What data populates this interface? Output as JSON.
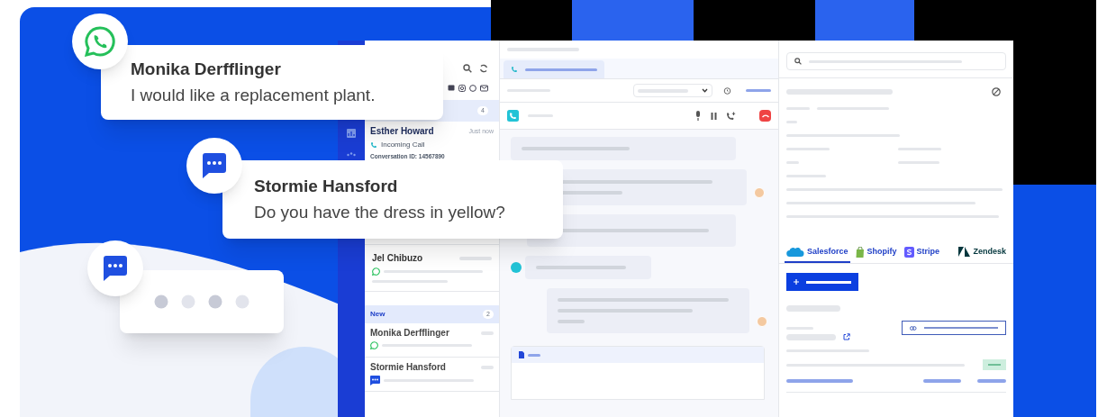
{
  "floating_messages": [
    {
      "kind": "whatsapp",
      "sender": "Monika Derfflinger",
      "text": "I would like a replacement plant."
    },
    {
      "kind": "chat",
      "sender": "Stormie Hansford",
      "text": "Do you have the dress in yellow?"
    },
    {
      "kind": "typing"
    }
  ],
  "conversation_list": {
    "open_count": "4",
    "active": {
      "name": "Esther Howard",
      "time": "Just now",
      "status": "Incoming Call",
      "conversation_id": "Conversation ID: 14567890"
    },
    "items": [
      {
        "name": "Jel Chibuzo",
        "kind": "whatsapp"
      }
    ],
    "new_section": {
      "label": "New",
      "count": "2",
      "items": [
        {
          "name": "Monika Derfflinger",
          "kind": "whatsapp"
        },
        {
          "name": "Stormie Hansford",
          "kind": "chat"
        }
      ]
    }
  },
  "integration_tabs": [
    {
      "label": "Salesforce",
      "kind": "salesforce",
      "selected": true
    },
    {
      "label": "Shopify",
      "kind": "shopify",
      "selected": false
    },
    {
      "label": "Stripe",
      "kind": "stripe",
      "selected": false
    },
    {
      "label": "Zendesk",
      "kind": "zendesk",
      "selected": false
    }
  ]
}
